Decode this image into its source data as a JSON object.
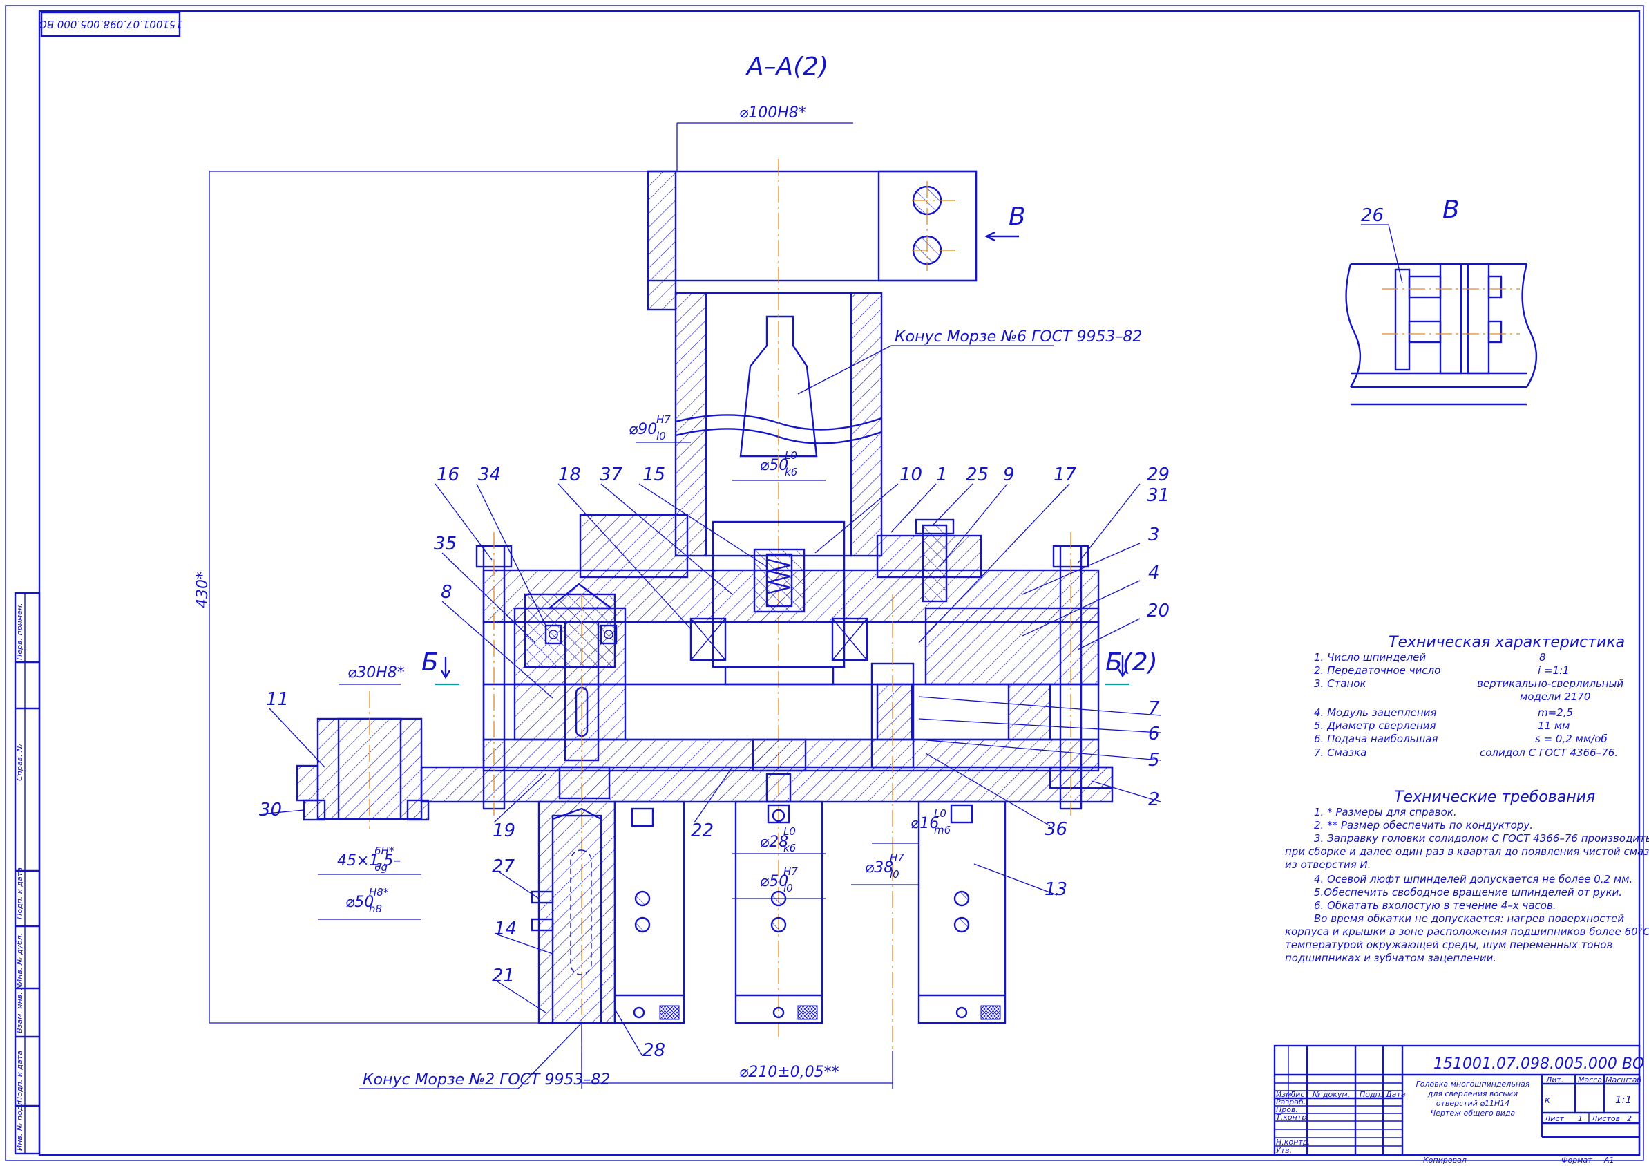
{
  "drawing": {
    "doc_number_top": "151001.07.098.005.000 ВО",
    "section_title": "А–А(2)",
    "view_title": "В",
    "view_marker": "В",
    "section_b_left": "Б",
    "section_b_right": "Б(2)"
  },
  "dimensions": {
    "d100": "⌀100H8*",
    "d90": "⌀90",
    "d90_fit_top": "H7",
    "d90_fit_bottom": "l0",
    "d50_top": "⌀50",
    "d50_top_fit_top": "L0",
    "d50_top_fit_bottom": "k6",
    "d30": "⌀30H8*",
    "thread": "45×1,5–",
    "thread_fit_top": "6H*",
    "thread_fit_bottom": "6g",
    "d50_left": "⌀50",
    "d50_left_fit_top": "H8*",
    "d50_left_fit_bottom": "h8",
    "d28": "⌀28",
    "d28_fit_top": "L0",
    "d28_fit_bottom": "k6",
    "d50_bottom": "⌀50",
    "d50_bottom_fit_top": "H7",
    "d50_bottom_fit_bottom": "l0",
    "d16": "⌀16",
    "d16_fit_top": "L0",
    "d16_fit_bottom": "m6",
    "d38": "⌀38",
    "d38_fit_top": "H7",
    "d38_fit_bottom": "l0",
    "d210": "⌀210±0,05**",
    "h430": "430*"
  },
  "callouts": {
    "morse6": "Конус Морзе №6 ГОСТ 9953–82",
    "morse2": "Конус Морзе №2 ГОСТ 9953–82"
  },
  "positions": [
    "16",
    "34",
    "18",
    "37",
    "15",
    "10",
    "1",
    "25",
    "9",
    "17",
    "29",
    "31",
    "3",
    "4",
    "20",
    "35",
    "8",
    "11",
    "30",
    "19",
    "22",
    "27",
    "14",
    "21",
    "28",
    "7",
    "6",
    "5",
    "2",
    "36",
    "13",
    "26"
  ],
  "tech_characteristics": {
    "title": "Техническая характеристика",
    "rows": [
      {
        "label": "1. Число шпинделей",
        "value": "8"
      },
      {
        "label": "2. Передаточное число",
        "value": "i =1:1"
      },
      {
        "label": "3. Станок",
        "value": "вертикально-сверлильный"
      },
      {
        "label": "",
        "value": "модели 2170"
      },
      {
        "label": "4. Модуль зацепления",
        "value": "m=2,5"
      },
      {
        "label": "5. Диаметр сверления",
        "value": "11 мм"
      },
      {
        "label": "6. Подача наибольшая",
        "value": "s = 0,2 мм/об"
      },
      {
        "label": "7. Смазка",
        "value": "солидол С ГОСТ 4366–76."
      }
    ]
  },
  "tech_requirements": {
    "title": "Технические требования",
    "lines": [
      "1. * Размеры для справок.",
      "2. ** Размер обеспечить по кондуктору.",
      "3. Заправку головки солидолом С ГОСТ 4366–76 производить",
      "при сборке и далее один раз в квартал до появления чистой смазки",
      "из отверстия И.",
      "4. Осевой люфт шпинделей допускается не более 0,2 мм.",
      "5.Обеспечить свободное вращение шпинделей от руки.",
      "6. Обкатать вхолостую в течение 4–х часов.",
      "Во время обкатки не допускается: нагрев поверхностей",
      "корпуса и крышки в зоне расположения подшипников более 60°С над",
      "температурой окружающей среды, шум переменных тонов",
      "подшипниках и зубчатом зацеплении."
    ]
  },
  "title_block": {
    "doc_number": "151001.07.098.005.000 ВО",
    "name_lines": [
      "Головка многошпиндельная",
      "для сверления восьми",
      "отверстий ⌀11Н14",
      "Чертеж общего вида"
    ],
    "cols": [
      "Изм.",
      "Лист",
      "№ докум.",
      "Подп.",
      "Дата"
    ],
    "roles": [
      "Разраб.",
      "Пров.",
      "Т.контр.",
      "",
      "Н.контр.",
      "Утв."
    ],
    "lit": "Лит.",
    "mass": "Масса",
    "scale": "Масштаб",
    "lit_value": "К",
    "scale_value": "1:1",
    "sheet": "Лист",
    "sheet_no": "1",
    "sheets": "Листов",
    "sheets_no": "2",
    "copied": "Копировал",
    "format": "Формат",
    "format_value": "А1"
  },
  "side_strip": [
    "Перв. примен.",
    "Справ. №",
    "Подп. и дата",
    "Инв. № дубл.",
    "Взам. инв. №",
    "Подп. и дата",
    "Инв. № подл."
  ]
}
